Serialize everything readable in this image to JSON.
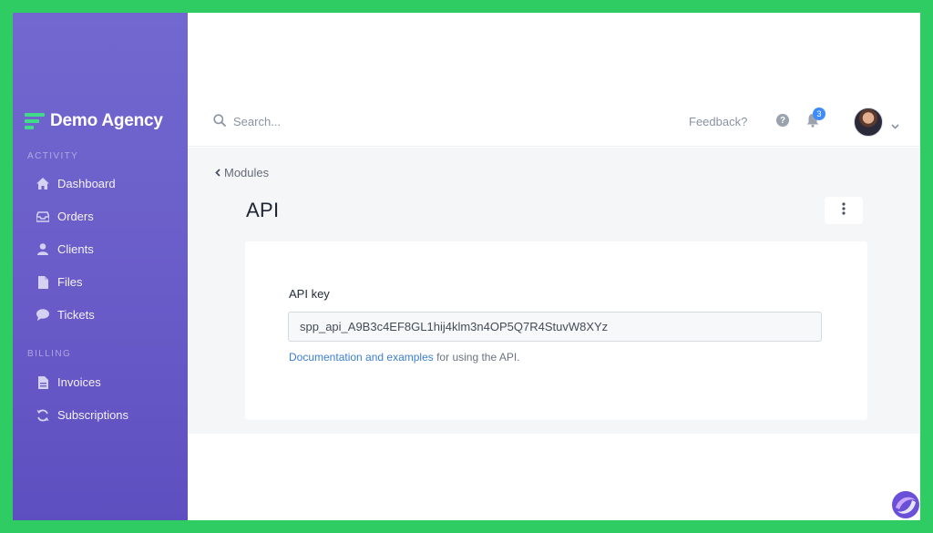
{
  "brand": {
    "name": "Demo Agency"
  },
  "sidebar": {
    "sections": [
      {
        "label": "ACTIVITY"
      },
      {
        "label": "BILLING"
      }
    ],
    "items": [
      {
        "label": "Dashboard",
        "icon": "home-icon"
      },
      {
        "label": "Orders",
        "icon": "inbox-icon"
      },
      {
        "label": "Clients",
        "icon": "user-icon"
      },
      {
        "label": "Files",
        "icon": "file-icon"
      },
      {
        "label": "Tickets",
        "icon": "chat-icon"
      },
      {
        "label": "Invoices",
        "icon": "invoice-icon"
      },
      {
        "label": "Subscriptions",
        "icon": "refresh-icon"
      }
    ]
  },
  "topbar": {
    "search_placeholder": "Search...",
    "feedback_label": "Feedback?",
    "help_glyph": "?",
    "notification_count": "3"
  },
  "breadcrumb": {
    "label": "Modules"
  },
  "page": {
    "title": "API"
  },
  "api": {
    "label": "API key",
    "value": "spp_api_A9B3c4EF8GL1hij4klm3n4OP5Q7R4StuvW8XYz",
    "help_link": "Documentation and examples",
    "help_suffix": " for using the API."
  },
  "colors": {
    "frame_border": "#2ecc63",
    "sidebar_top": "#7268cf",
    "sidebar_bottom": "#5e4fc0",
    "accent_green": "#41d98a",
    "link": "#3b7fd0",
    "badge": "#3d8bfd"
  }
}
